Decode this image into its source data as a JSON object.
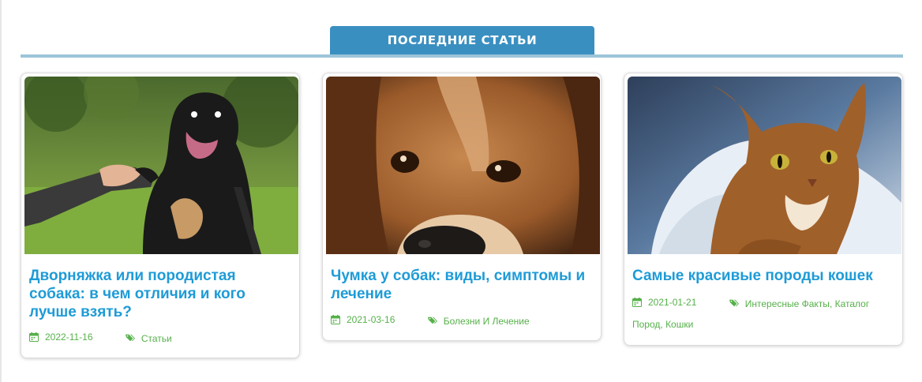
{
  "section": {
    "heading": "ПОСЛЕДНИЕ СТАТЬИ"
  },
  "colors": {
    "accent": "#3a8fc1",
    "title": "#1e9bd7",
    "meta": "#56b04a"
  },
  "icons": {
    "date": "calendar-icon",
    "categories": "tags-icon"
  },
  "cards": [
    {
      "image_alt": "dog-giving-paw-photo",
      "title": "Дворняжка или породистая собака: в чем отличия и кого лучше взять?",
      "date": "2022-11-16",
      "categories": [
        "Статьи"
      ]
    },
    {
      "image_alt": "beagle-closeup-photo",
      "title": "Чумка у собак: виды, симптомы и лечение",
      "date": "2021-03-16",
      "categories": [
        "Болезни И Лечение"
      ]
    },
    {
      "image_alt": "abyssinian-cat-photo",
      "title": "Самые красивые породы кошек",
      "date": "2021-01-21",
      "categories": [
        "Интересные Факты",
        "Каталог Пород",
        "Кошки"
      ]
    }
  ]
}
